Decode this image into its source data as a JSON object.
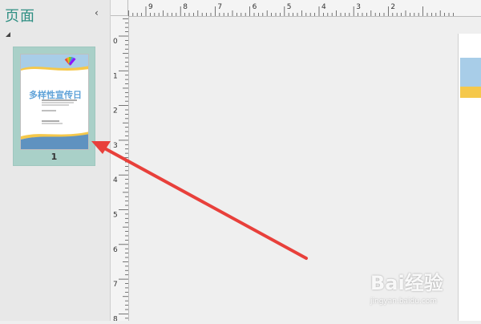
{
  "pane": {
    "title": "页面",
    "close_glyph": "‹",
    "pages": [
      {
        "number": "1"
      }
    ]
  },
  "thumbnail": {
    "title": "多样性宣传日",
    "colors": {
      "wave_blue": "#5f92c0",
      "wave_yellow": "#f5c84b",
      "sky": "#a8cde8",
      "title_blue": "#5fa2d8"
    }
  },
  "rulers": {
    "horizontal_labels": [
      "9",
      "8",
      "7",
      "6",
      "5",
      "4",
      "3",
      "2"
    ],
    "vertical_labels": [
      "0",
      "1",
      "2",
      "3",
      "4",
      "5",
      "6",
      "7",
      "8"
    ]
  },
  "annotation": {
    "arrow_color": "#e8403b"
  },
  "watermark": {
    "brand": "Bai经验",
    "url": "jingyan.baidu.com"
  }
}
